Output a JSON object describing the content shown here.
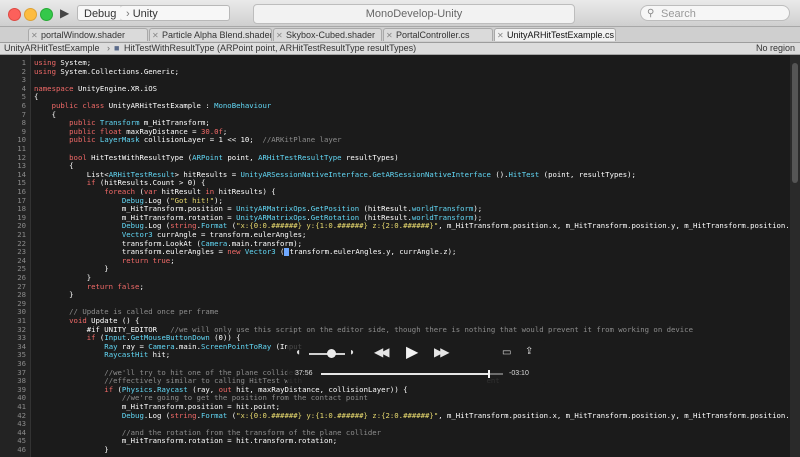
{
  "colors": {
    "keyword": "#f26a68",
    "type": "#62d8f6",
    "comment": "#8d8d8d",
    "string": "#e7d96e",
    "editor_bg": "#1b1b1b"
  },
  "toolbar": {
    "scheme_label": "Debug",
    "target_label": "Unity",
    "window_title": "MonoDevelop-Unity",
    "search_placeholder": "Search"
  },
  "tabs": [
    {
      "label": "portalWindow.shader",
      "active": false
    },
    {
      "label": "Particle Alpha Blend.shader",
      "active": false
    },
    {
      "label": "Skybox-Cubed.shader",
      "active": false
    },
    {
      "label": "PortalController.cs",
      "active": false
    },
    {
      "label": "UnityARHitTestExample.cs",
      "active": true
    }
  ],
  "path_bar": {
    "class_name": "UnityARHitTestExample",
    "method_signature": "HitTestWithResultType (ARPoint point, ARHitTestResultType resultTypes)",
    "region": "No region"
  },
  "code_lines": [
    {
      "n": "1",
      "t": [
        [
          "using",
          "k"
        ],
        [
          " System;",
          ""
        ]
      ]
    },
    {
      "n": "2",
      "t": [
        [
          "using",
          "k"
        ],
        [
          " System.Collections.Generic;",
          ""
        ]
      ]
    },
    {
      "n": "3",
      "t": []
    },
    {
      "n": "4",
      "t": [
        [
          "namespace",
          "k"
        ],
        [
          " UnityEngine.XR.iOS",
          ""
        ]
      ]
    },
    {
      "n": "5",
      "t": [
        [
          "{",
          ""
        ]
      ]
    },
    {
      "n": "6",
      "t": [
        [
          "    ",
          ""
        ],
        [
          "public class",
          "k"
        ],
        [
          " UnityARHitTestExample : ",
          ""
        ],
        [
          "MonoBehaviour",
          "ty"
        ]
      ]
    },
    {
      "n": "7",
      "t": [
        [
          "    {",
          ""
        ]
      ]
    },
    {
      "n": "8",
      "t": [
        [
          "        ",
          ""
        ],
        [
          "public",
          "k"
        ],
        [
          " ",
          ""
        ],
        [
          "Transform",
          "ty"
        ],
        [
          " m_HitTransform;",
          ""
        ]
      ]
    },
    {
      "n": "9",
      "t": [
        [
          "        ",
          ""
        ],
        [
          "public float",
          "k"
        ],
        [
          " maxRayDistance = ",
          ""
        ],
        [
          "30.0f",
          "k"
        ],
        [
          ";",
          ""
        ]
      ]
    },
    {
      "n": "10",
      "t": [
        [
          "        ",
          ""
        ],
        [
          "public",
          "k"
        ],
        [
          " ",
          ""
        ],
        [
          "LayerMask",
          "ty"
        ],
        [
          " collisionLayer = 1 << 10;  ",
          ""
        ],
        [
          "//ARKitPlane layer",
          "c"
        ]
      ]
    },
    {
      "n": "11",
      "t": []
    },
    {
      "n": "12",
      "t": [
        [
          "        ",
          ""
        ],
        [
          "bool",
          "k"
        ],
        [
          " HitTestWithResultType (",
          ""
        ],
        [
          "ARPoint",
          "ty"
        ],
        [
          " point, ",
          ""
        ],
        [
          "ARHitTestResultType",
          "ty"
        ],
        [
          " resultTypes)",
          ""
        ]
      ]
    },
    {
      "n": "13",
      "t": [
        [
          "        {",
          ""
        ]
      ]
    },
    {
      "n": "14",
      "t": [
        [
          "            List<",
          ""
        ],
        [
          "ARHitTestResult",
          "ty"
        ],
        [
          "> hitResults = ",
          ""
        ],
        [
          "UnityARSessionNativeInterface",
          "ty"
        ],
        [
          ".",
          ""
        ],
        [
          "GetARSessionNativeInterface",
          "ty"
        ],
        [
          " ().",
          ""
        ],
        [
          "HitTest",
          "ty"
        ],
        [
          " (point, resultTypes);",
          ""
        ]
      ]
    },
    {
      "n": "15",
      "t": [
        [
          "            ",
          ""
        ],
        [
          "if",
          "k"
        ],
        [
          " (hitResults.Count > 0) {",
          ""
        ]
      ]
    },
    {
      "n": "16",
      "t": [
        [
          "                ",
          ""
        ],
        [
          "foreach",
          "k"
        ],
        [
          " (",
          ""
        ],
        [
          "var",
          "k"
        ],
        [
          " hitResult ",
          ""
        ],
        [
          "in",
          "k"
        ],
        [
          " hitResults) {",
          ""
        ]
      ]
    },
    {
      "n": "17",
      "t": [
        [
          "                    ",
          ""
        ],
        [
          "Debug",
          "ty"
        ],
        [
          ".Log (",
          ""
        ],
        [
          "\"Got hit!\"",
          "s"
        ],
        [
          ");",
          ""
        ]
      ]
    },
    {
      "n": "18",
      "t": [
        [
          "                    m_HitTransform.position = ",
          ""
        ],
        [
          "UnityARMatrixOps",
          "ty"
        ],
        [
          ".",
          ""
        ],
        [
          "GetPosition",
          "ty"
        ],
        [
          " (hitResult.",
          ""
        ],
        [
          "worldTransform",
          "ty"
        ],
        [
          ");",
          ""
        ]
      ]
    },
    {
      "n": "19",
      "t": [
        [
          "                    m_HitTransform.rotation = ",
          ""
        ],
        [
          "UnityARMatrixOps",
          "ty"
        ],
        [
          ".",
          ""
        ],
        [
          "GetRotation",
          "ty"
        ],
        [
          " (hitResult.",
          ""
        ],
        [
          "worldTransform",
          "ty"
        ],
        [
          ");",
          ""
        ]
      ]
    },
    {
      "n": "20",
      "t": [
        [
          "                    ",
          ""
        ],
        [
          "Debug",
          "ty"
        ],
        [
          ".Log (",
          ""
        ],
        [
          "string",
          "k"
        ],
        [
          ".",
          ""
        ],
        [
          "Format",
          "ty"
        ],
        [
          " (",
          ""
        ],
        [
          "\"x:{0:0.######} y:{1:0.######} z:{2:0.######}\"",
          "s"
        ],
        [
          ", m_HitTransform.position.x, m_HitTransform.position.y, m_HitTransform.position.z));",
          ""
        ]
      ]
    },
    {
      "n": "21",
      "t": [
        [
          "                    ",
          ""
        ],
        [
          "Vector3",
          "ty"
        ],
        [
          " currAngle = transform.eulerAngles;",
          ""
        ]
      ]
    },
    {
      "n": "22",
      "t": [
        [
          "                    transform.LookAt (",
          ""
        ],
        [
          "Camera",
          "ty"
        ],
        [
          ".main.transform);",
          ""
        ]
      ]
    },
    {
      "n": "23",
      "t": [
        [
          "                    transform.eulerAngles = ",
          ""
        ],
        [
          "new",
          "k"
        ],
        [
          " ",
          ""
        ],
        [
          "Vector3",
          "ty"
        ],
        [
          " (",
          ""
        ],
        [
          "CURSOR",
          "cur"
        ],
        [
          "transform.eulerAngles.y, currAngle.z);",
          ""
        ]
      ]
    },
    {
      "n": "24",
      "t": [
        [
          "                    ",
          ""
        ],
        [
          "return true",
          "k"
        ],
        [
          ";",
          ""
        ]
      ]
    },
    {
      "n": "25",
      "t": [
        [
          "                }",
          ""
        ]
      ]
    },
    {
      "n": "26",
      "t": [
        [
          "            }",
          ""
        ]
      ]
    },
    {
      "n": "27",
      "t": [
        [
          "            ",
          ""
        ],
        [
          "return false",
          "k"
        ],
        [
          ";",
          ""
        ]
      ]
    },
    {
      "n": "28",
      "t": [
        [
          "        }",
          ""
        ]
      ]
    },
    {
      "n": "29",
      "t": []
    },
    {
      "n": "30",
      "t": [
        [
          "        ",
          ""
        ],
        [
          "// Update is called once per frame",
          "c"
        ]
      ]
    },
    {
      "n": "31",
      "t": [
        [
          "        ",
          ""
        ],
        [
          "void",
          "k"
        ],
        [
          " Update () {",
          ""
        ]
      ]
    },
    {
      "n": "32",
      "t": [
        [
          "            #if UNITY_EDITOR   ",
          ""
        ],
        [
          "//we will only use this script on the editor side, though there is nothing that would prevent it from working on device",
          "c"
        ]
      ]
    },
    {
      "n": "33",
      "t": [
        [
          "            ",
          ""
        ],
        [
          "if",
          "k"
        ],
        [
          " (",
          ""
        ],
        [
          "Input",
          "ty"
        ],
        [
          ".",
          ""
        ],
        [
          "GetMouseButtonDown",
          "ty"
        ],
        [
          " (0)) {",
          ""
        ]
      ]
    },
    {
      "n": "34",
      "t": [
        [
          "                ",
          ""
        ],
        [
          "Ray",
          "ty"
        ],
        [
          " ray = ",
          ""
        ],
        [
          "Camera",
          "ty"
        ],
        [
          ".main.",
          ""
        ],
        [
          "ScreenPointToRay",
          "ty"
        ],
        [
          " (Input",
          ""
        ]
      ]
    },
    {
      "n": "35",
      "t": [
        [
          "                ",
          ""
        ],
        [
          "RaycastHit",
          "ty"
        ],
        [
          " hit;",
          ""
        ]
      ]
    },
    {
      "n": "36",
      "t": []
    },
    {
      "n": "37",
      "t": [
        [
          "                ",
          ""
        ],
        [
          "//we'll try to hit one of the plane collider",
          "c"
        ]
      ]
    },
    {
      "n": "38",
      "t": [
        [
          "                ",
          ""
        ],
        [
          "//effectively similar to calling HitTest with",
          "c"
        ],
        [
          "                                          ",
          ""
        ],
        [
          "ent",
          "c"
        ]
      ]
    },
    {
      "n": "39",
      "t": [
        [
          "                ",
          ""
        ],
        [
          "if",
          "k"
        ],
        [
          " (",
          ""
        ],
        [
          "Physics",
          "ty"
        ],
        [
          ".",
          ""
        ],
        [
          "Raycast",
          "ty"
        ],
        [
          " (ray, ",
          ""
        ],
        [
          "out",
          "k"
        ],
        [
          " hit, maxRayDistance, collisionLayer)) {",
          ""
        ]
      ]
    },
    {
      "n": "40",
      "t": [
        [
          "                    ",
          ""
        ],
        [
          "//we're going to get the position from the contact point",
          "c"
        ]
      ]
    },
    {
      "n": "41",
      "t": [
        [
          "                    m_HitTransform.position = hit.point;",
          ""
        ]
      ]
    },
    {
      "n": "42",
      "t": [
        [
          "                    ",
          ""
        ],
        [
          "Debug",
          "ty"
        ],
        [
          ".Log (",
          ""
        ],
        [
          "string",
          "k"
        ],
        [
          ".",
          ""
        ],
        [
          "Format",
          "ty"
        ],
        [
          " (",
          ""
        ],
        [
          "\"x:{0:0.######} y:{1:0.######} z:{2:0.######}\"",
          "s"
        ],
        [
          ", m_HitTransform.position.x, m_HitTransform.position.y, m_HitTransform.position.z));",
          ""
        ]
      ]
    },
    {
      "n": "43",
      "t": []
    },
    {
      "n": "44",
      "t": [
        [
          "                    ",
          ""
        ],
        [
          "//and the rotation from the transform of the plane collider",
          "c"
        ]
      ]
    },
    {
      "n": "45",
      "t": [
        [
          "                    m_HitTransform.rotation = hit.transform.rotation;",
          ""
        ]
      ]
    },
    {
      "n": "46",
      "t": [
        [
          "                }",
          ""
        ]
      ]
    }
  ],
  "media": {
    "elapsed": "37:56",
    "remaining": "-03:10",
    "progress": 0.922
  }
}
